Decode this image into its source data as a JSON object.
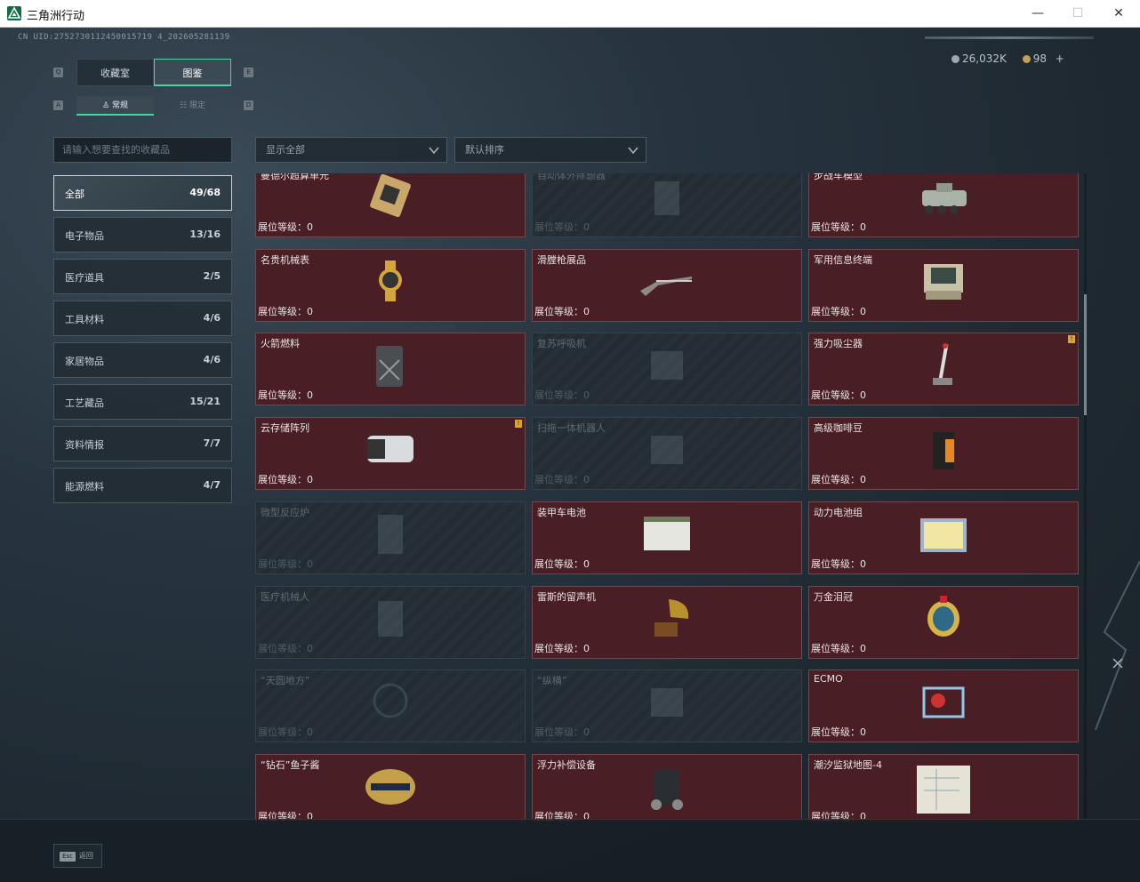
{
  "window": {
    "title": "三角洲行动",
    "minimize": "—",
    "maximize": "☐",
    "close": "✕"
  },
  "uid": "CN UID:2752730112450015719 4_202605281139",
  "currency": {
    "coins": "26,032K",
    "tickets": "98",
    "add": "+"
  },
  "key_hints": {
    "tab_prev": "Q",
    "tab_next": "E",
    "sub_prev": "A",
    "sub_next": "D"
  },
  "tabs": [
    {
      "label": "收藏室",
      "active": false
    },
    {
      "label": "图鉴",
      "active": true
    }
  ],
  "subtabs": [
    {
      "label": "常规",
      "active": true
    },
    {
      "label": "限定",
      "active": false
    }
  ],
  "search": {
    "placeholder": "请输入想要查找的收藏品"
  },
  "categories": [
    {
      "label": "全部",
      "count": "49/68",
      "active": true
    },
    {
      "label": "电子物品",
      "count": "13/16"
    },
    {
      "label": "医疗道具",
      "count": "2/5"
    },
    {
      "label": "工具材料",
      "count": "4/6"
    },
    {
      "label": "家居物品",
      "count": "4/6"
    },
    {
      "label": "工艺藏品",
      "count": "15/21"
    },
    {
      "label": "资料情报",
      "count": "7/7"
    },
    {
      "label": "能源燃料",
      "count": "4/7"
    }
  ],
  "filters": {
    "display": "显示全部",
    "sort": "默认排序"
  },
  "level_label": "展位等级：",
  "items": [
    {
      "name": "曼德尔超算单元",
      "level": "0",
      "owned": true,
      "icon": "gpu-icon"
    },
    {
      "name": "自动体外除颤器",
      "level": "0",
      "owned": false,
      "icon": "defibrillator-icon"
    },
    {
      "name": "步战车模型",
      "level": "0",
      "owned": true,
      "icon": "ifv-model-icon"
    },
    {
      "name": "名贵机械表",
      "level": "0",
      "owned": true,
      "icon": "watch-icon"
    },
    {
      "name": "滑膛枪展品",
      "level": "0",
      "owned": true,
      "icon": "musket-icon"
    },
    {
      "name": "军用信息终端",
      "level": "0",
      "owned": true,
      "icon": "terminal-icon"
    },
    {
      "name": "火箭燃料",
      "level": "0",
      "owned": true,
      "icon": "fuel-can-icon"
    },
    {
      "name": "复苏呼吸机",
      "level": "0",
      "owned": false,
      "icon": "ventilator-icon"
    },
    {
      "name": "强力吸尘器",
      "level": "0",
      "owned": true,
      "icon": "vacuum-icon",
      "badge": "!"
    },
    {
      "name": "云存储阵列",
      "level": "0",
      "owned": true,
      "icon": "storage-array-icon",
      "badge": "!"
    },
    {
      "name": "扫拖一体机器人",
      "level": "0",
      "owned": false,
      "icon": "robot-vacuum-icon"
    },
    {
      "name": "高级咖啡豆",
      "level": "0",
      "owned": true,
      "icon": "coffee-bag-icon"
    },
    {
      "name": "微型反应炉",
      "level": "0",
      "owned": false,
      "icon": "reactor-icon"
    },
    {
      "name": "装甲车电池",
      "level": "0",
      "owned": true,
      "icon": "battery-icon"
    },
    {
      "name": "动力电池组",
      "level": "0",
      "owned": true,
      "icon": "battery-pack-icon"
    },
    {
      "name": "医疗机械人",
      "level": "0",
      "owned": false,
      "icon": "medical-robot-icon"
    },
    {
      "name": "雷斯的留声机",
      "level": "0",
      "owned": true,
      "icon": "gramophone-icon"
    },
    {
      "name": "万金泪冠",
      "level": "0",
      "owned": true,
      "icon": "crown-egg-icon"
    },
    {
      "name": "“天圆地方”",
      "level": "0",
      "owned": false,
      "icon": "globe-icon"
    },
    {
      "name": "“纵横”",
      "level": "0",
      "owned": false,
      "icon": "chessboard-icon"
    },
    {
      "name": "ECMO",
      "level": "0",
      "owned": true,
      "icon": "ecmo-icon"
    },
    {
      "name": "“钻石”鱼子酱",
      "level": "0",
      "owned": true,
      "icon": "caviar-tin-icon"
    },
    {
      "name": "浮力补偿设备",
      "level": "0",
      "owned": true,
      "icon": "bcd-icon"
    },
    {
      "name": "潮汐监狱地图-4",
      "level": "0",
      "owned": true,
      "icon": "map-icon"
    }
  ],
  "footer": {
    "back_key": "Esc",
    "back_label": "返回"
  }
}
